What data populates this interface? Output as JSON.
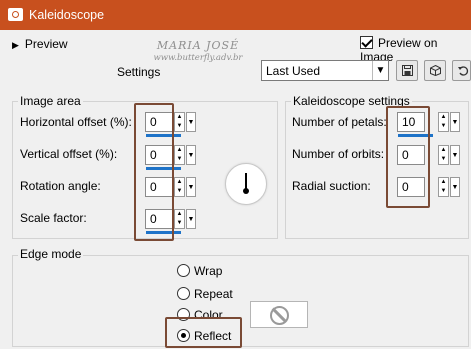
{
  "window": {
    "title": "Kaleidoscope",
    "icon": "camera-icon"
  },
  "toolbar": {
    "preview_label": "Preview",
    "preview_on_image_label": "Preview on Image",
    "preview_on_image_checked": true,
    "settings_label": "Settings",
    "preset_value": "Last Used",
    "save_icon": "save-preset-icon",
    "cube_icon": "randomize-icon",
    "reset_icon": "reset-icon"
  },
  "watermark": {
    "line1": "MARIA JOSÉ",
    "line2": "www.butterfly.adv.br"
  },
  "image_area": {
    "title": "Image area",
    "horizontal_offset": {
      "label": "Horizontal offset (%):",
      "value": "0"
    },
    "vertical_offset": {
      "label": "Vertical offset (%):",
      "value": "0"
    },
    "rotation_angle": {
      "label": "Rotation angle:",
      "value": "0"
    },
    "scale_factor": {
      "label": "Scale factor:",
      "value": "0"
    }
  },
  "kaleidoscope": {
    "title": "Kaleidoscope settings",
    "petals": {
      "label": "Number of petals:",
      "value": "10"
    },
    "orbits": {
      "label": "Number of orbits:",
      "value": "0"
    },
    "suction": {
      "label": "Radial suction:",
      "value": "0"
    }
  },
  "edge_mode": {
    "title": "Edge mode",
    "options": [
      "Wrap",
      "Repeat",
      "Color",
      "Reflect"
    ],
    "selected": "Reflect"
  },
  "colors": {
    "titlebar": "#c8501e",
    "accent": "#1e73c8",
    "highlight": "#7a4a35"
  }
}
